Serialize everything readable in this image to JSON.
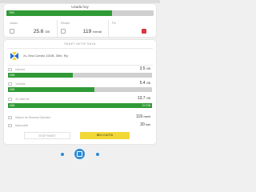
{
  "quota": {
    "title": "Usada hoy",
    "bar_fill_percent": 72,
    "bar_label": "76%",
    "stats": [
      {
        "label": "Usado",
        "value": "25.6",
        "unit": "GB",
        "icon": "data-icon"
      },
      {
        "label": "Restan",
        "value": "119",
        "unit": "mendi",
        "icon": "clock-icon"
      },
      {
        "label": "Fin",
        "value": "",
        "unit": "",
        "icon": "calendar-icon"
      }
    ]
  },
  "contract": {
    "title": "PAKET AKTIF SAYA",
    "plan_name": "XL Xtra Combo 15GB, 30hr, Rp",
    "rows": [
      {
        "label": "Internet",
        "value": "3.5",
        "unit": "GB"
      },
      {
        "label": "Youtube",
        "value": "5.4",
        "unit": "GB"
      },
      {
        "label": "4G Internet",
        "value": "13.7",
        "unit": "GB"
      }
    ],
    "bars": [
      {
        "fill_percent": 45,
        "left_label": "0GB",
        "right_label": ""
      },
      {
        "fill_percent": 60,
        "left_label": "0GB",
        "right_label": ""
      },
      {
        "fill_percent": 100,
        "left_label": "0GB",
        "right_label": "13.7GB"
      }
    ],
    "extra_rows": [
      {
        "label": "Nelpon ke Sesama Operator",
        "value": "119",
        "unit": "menit"
      },
      {
        "label": "Masa aktif",
        "value": "20",
        "unit": "hari"
      }
    ],
    "button_off": "STOP PAKET",
    "button_more": "BELI KUOTA"
  },
  "colors": {
    "accent_green": "#2f9a36",
    "accent_blue": "#2a8bd8",
    "accent_yellow": "#f1d836",
    "accent_red": "#d9363e"
  }
}
